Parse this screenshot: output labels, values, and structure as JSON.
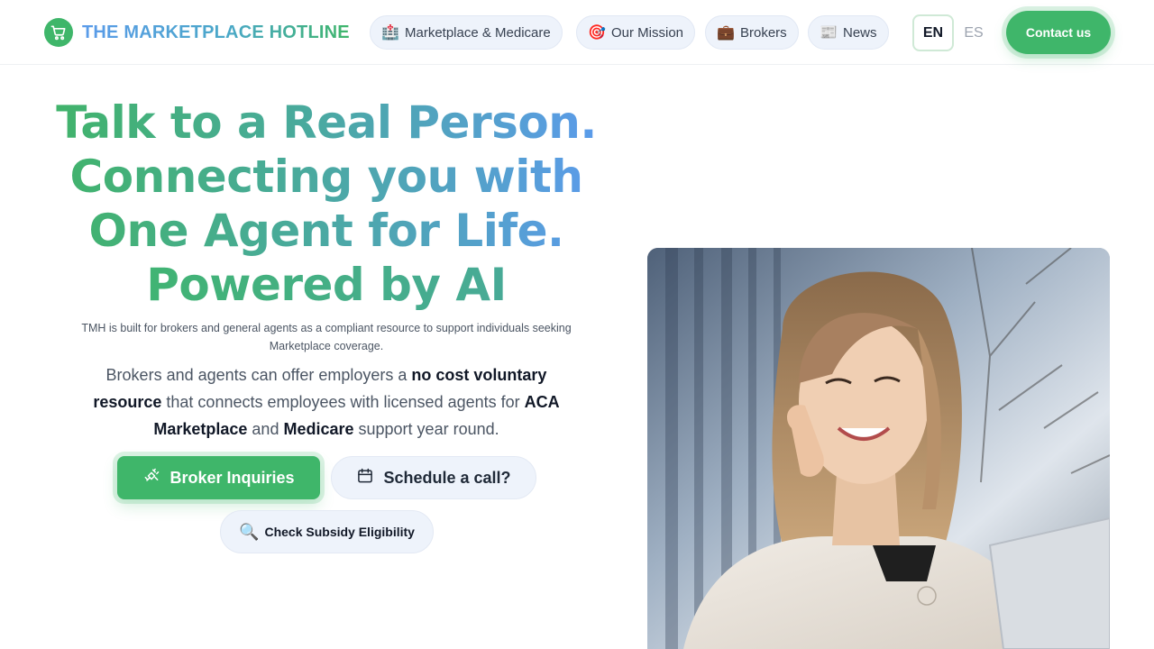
{
  "header": {
    "brand_name": "THE MARKETPLACE HOTLINE",
    "brand_icon": "cart-icon",
    "nav": [
      {
        "label": "Marketplace & Medicare",
        "icon": "hospital-icon"
      },
      {
        "label": "Our Mission",
        "icon": "target-icon"
      },
      {
        "label": "Brokers",
        "icon": "briefcase-icon"
      },
      {
        "label": "News",
        "icon": "newspaper-icon"
      }
    ],
    "lang_en": "EN",
    "lang_es": "ES",
    "contact_label": "Contact us"
  },
  "hero": {
    "title_lines": [
      "Talk to a Real Person.",
      "Connecting you with",
      "One Agent for Life.",
      "Powered by AI"
    ],
    "subtitle_small": "TMH is built for brokers and general agents as a compliant resource to support individuals seeking Marketplace coverage.",
    "subtitle_parts": {
      "p1": "Brokers and agents can offer employers a ",
      "b1": "no cost voluntary resource",
      "p2": " that connects employees with licensed agents for ",
      "b2": "ACA Marketplace",
      "p3": " and ",
      "b3": "Medicare",
      "p4": " support year round."
    },
    "btn_broker": "Broker Inquiries",
    "btn_schedule": "Schedule a call?",
    "btn_subsidy": "Check Subsidy Eligibility"
  },
  "colors": {
    "accent_green": "#3fb66a",
    "accent_blue": "#5b9bea",
    "pill_bg": "#eef3fb"
  }
}
